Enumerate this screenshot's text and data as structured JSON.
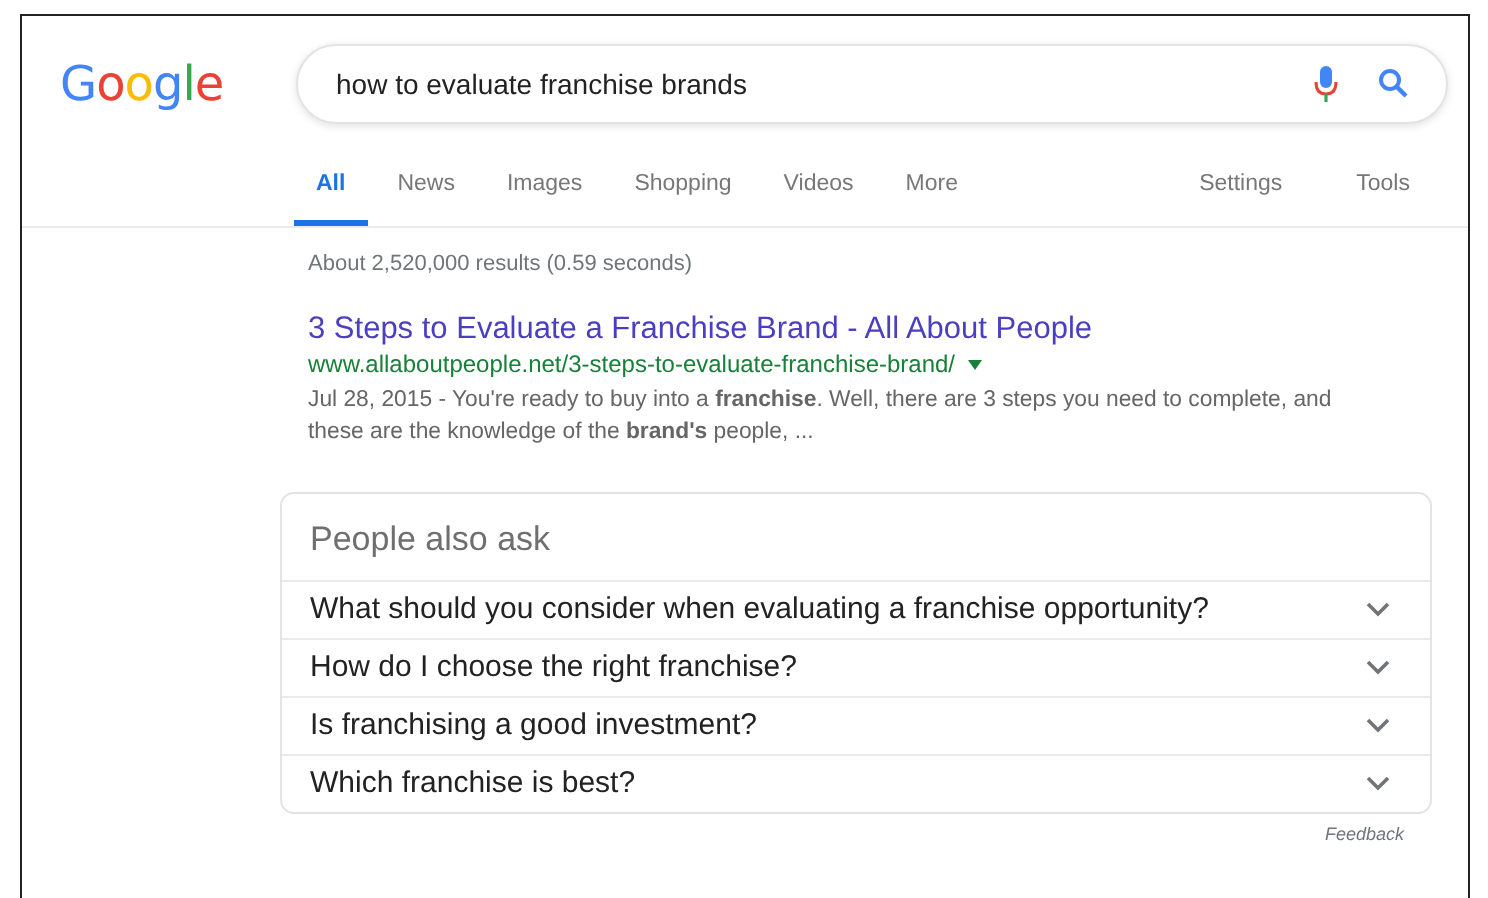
{
  "logo": "Google",
  "search": {
    "value": "how to evaluate franchise brands"
  },
  "tabs": [
    {
      "label": "All",
      "selected": true
    },
    {
      "label": "News",
      "selected": false
    },
    {
      "label": "Images",
      "selected": false
    },
    {
      "label": "Shopping",
      "selected": false
    },
    {
      "label": "Videos",
      "selected": false
    },
    {
      "label": "More",
      "selected": false
    }
  ],
  "tools": [
    "Settings",
    "Tools"
  ],
  "result_stats": "About 2,520,000 results (0.59 seconds)",
  "results": [
    {
      "title": "3 Steps to Evaluate a Franchise Brand - All About People",
      "url": "www.allaboutpeople.net/3-steps-to-evaluate-franchise-brand/",
      "snippet": "Jul 28, 2015 - You're ready to buy into a **franchise**. Well, there are 3 steps you need to complete, and these are the knowledge of the **brand's** people, ..."
    }
  ],
  "people_also_ask": {
    "heading": "People also ask",
    "questions": [
      {
        "text": "What should you consider when evaluating a franchise opportunity?",
        "expanded": false
      },
      {
        "text": "How do I choose the right franchise?",
        "expanded": false
      },
      {
        "text": "Is franchising a good investment?",
        "expanded": false
      },
      {
        "text": "Which franchise is best?",
        "expanded": false
      }
    ],
    "feedback": "Feedback"
  }
}
